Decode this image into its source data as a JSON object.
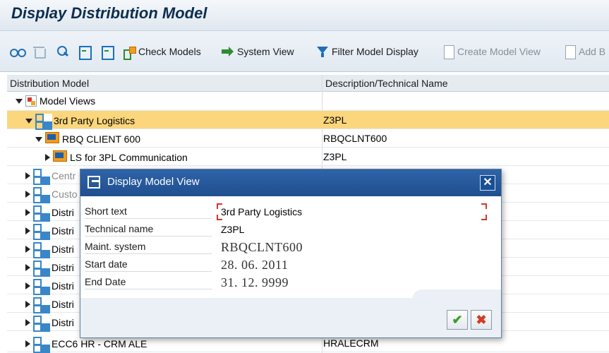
{
  "window": {
    "title": "Display Distribution Model"
  },
  "toolbar": {
    "check_models": "Check Models",
    "system_view": "System View",
    "filter_model_display": "Filter Model Display",
    "create_model_view": "Create Model View",
    "add_b": "Add B"
  },
  "tree": {
    "col_name": "Distribution Model",
    "col_desc": "Description/Technical Name",
    "rows": [
      {
        "name": "Model Views",
        "desc": ""
      },
      {
        "name": "3rd Party Logistics",
        "desc": "Z3PL"
      },
      {
        "name": "RBQ CLIENT 600",
        "desc": "RBQCLNT600"
      },
      {
        "name": "LS for 3PL Communication",
        "desc": "Z3PL"
      },
      {
        "name": "Centr",
        "desc": ""
      },
      {
        "name": "Custo",
        "desc": ""
      },
      {
        "name": "Distri",
        "desc": ""
      },
      {
        "name": "Distri",
        "desc": ""
      },
      {
        "name": "Distri",
        "desc": ""
      },
      {
        "name": "Distri",
        "desc": ""
      },
      {
        "name": "Distri",
        "desc": ""
      },
      {
        "name": "Distri",
        "desc": ""
      },
      {
        "name": "Distri",
        "desc": ""
      },
      {
        "name": "ECC6 HR - CRM ALE",
        "desc": "HRALECRM"
      }
    ]
  },
  "dialog": {
    "title": "Display Model View",
    "fields": [
      {
        "label": "Short text",
        "value": "3rd Party Logistics"
      },
      {
        "label": "Technical name",
        "value": "Z3PL"
      },
      {
        "label": "Maint. system",
        "value": "RBQCLNT600"
      },
      {
        "label": "Start date",
        "value": "28. 06. 2011"
      },
      {
        "label": "End Date",
        "value": "31. 12. 9999"
      }
    ],
    "ok_symbol": "✔",
    "cancel_symbol": "✖",
    "close_symbol": "✕"
  }
}
